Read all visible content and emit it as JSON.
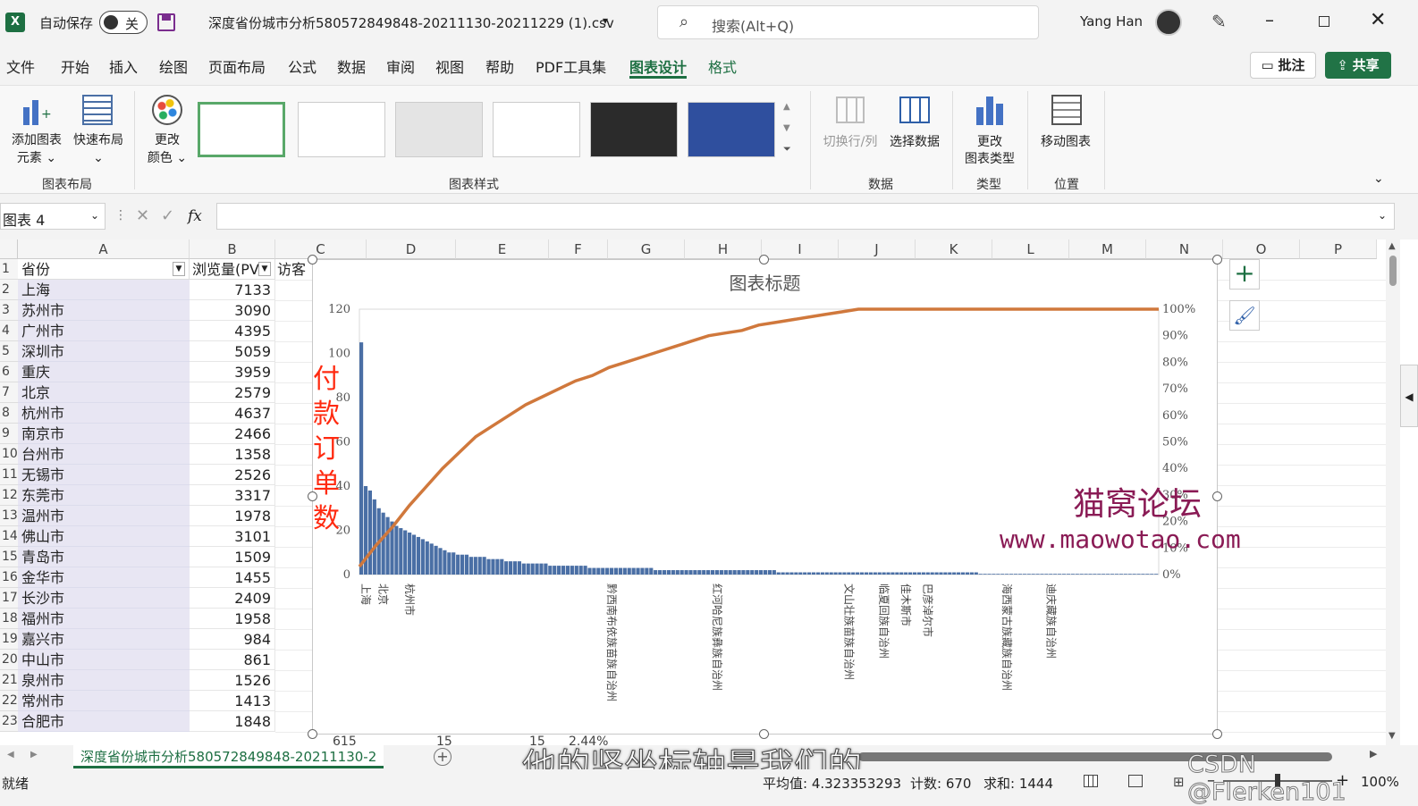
{
  "titlebar": {
    "autosave_label": "自动保存",
    "autosave_state": "关",
    "filename": "深度省份城市分析580572849848-20211130-20211229 (1).csv",
    "search_placeholder": "搜索(Alt+Q)",
    "user": "Yang Han"
  },
  "menu": [
    "文件",
    "开始",
    "插入",
    "绘图",
    "页面布局",
    "公式",
    "数据",
    "审阅",
    "视图",
    "帮助",
    "PDF工具集",
    "图表设计",
    "格式"
  ],
  "menu_active": "图表设计",
  "comments_label": "批注",
  "share_label": "共享",
  "ribbon": {
    "add_element": [
      "添加图表",
      "元素 ⌄"
    ],
    "quick_layout": [
      "快速布局",
      "⌄"
    ],
    "change_color": [
      "更改",
      "颜色 ⌄"
    ],
    "group_layout": "图表布局",
    "group_styles": "图表样式",
    "switch_rowcol": "切换行/列",
    "select_data": "选择数据",
    "group_data": "数据",
    "change_type": [
      "更改",
      "图表类型"
    ],
    "group_type": "类型",
    "move_chart": "移动图表",
    "group_location": "位置"
  },
  "formula": {
    "namebox": "图表 4",
    "fx": "fx"
  },
  "columns": [
    "A",
    "B",
    "C",
    "D",
    "E",
    "F",
    "G",
    "H",
    "I",
    "J",
    "K",
    "L",
    "M",
    "N",
    "O",
    "P"
  ],
  "headers": {
    "a": "省份",
    "b": "浏览量(PV",
    "c": "访客"
  },
  "rows": [
    {
      "n": "2",
      "a": "上海",
      "b": "7133"
    },
    {
      "n": "3",
      "a": "苏州市",
      "b": "3090"
    },
    {
      "n": "4",
      "a": "广州市",
      "b": "4395"
    },
    {
      "n": "5",
      "a": "深圳市",
      "b": "5059"
    },
    {
      "n": "6",
      "a": "重庆",
      "b": "3959"
    },
    {
      "n": "7",
      "a": "北京",
      "b": "2579"
    },
    {
      "n": "8",
      "a": "杭州市",
      "b": "4637"
    },
    {
      "n": "9",
      "a": "南京市",
      "b": "2466"
    },
    {
      "n": "10",
      "a": "台州市",
      "b": "1358"
    },
    {
      "n": "11",
      "a": "无锡市",
      "b": "2526"
    },
    {
      "n": "12",
      "a": "东莞市",
      "b": "3317"
    },
    {
      "n": "13",
      "a": "温州市",
      "b": "1978"
    },
    {
      "n": "14",
      "a": "佛山市",
      "b": "3101"
    },
    {
      "n": "15",
      "a": "青岛市",
      "b": "1509"
    },
    {
      "n": "16",
      "a": "金华市",
      "b": "1455"
    },
    {
      "n": "17",
      "a": "长沙市",
      "b": "2409"
    },
    {
      "n": "18",
      "a": "福州市",
      "b": "1958"
    },
    {
      "n": "19",
      "a": "嘉兴市",
      "b": "984"
    },
    {
      "n": "20",
      "a": "中山市",
      "b": "861"
    },
    {
      "n": "21",
      "a": "泉州市",
      "b": "1526"
    },
    {
      "n": "22",
      "a": "常州市",
      "b": "1413"
    },
    {
      "n": "23",
      "a": "合肥市",
      "b": "1848"
    }
  ],
  "chart_data": {
    "type": "bar",
    "title": "图表标题",
    "annotation": "付款订单数",
    "ylim": [
      0,
      120
    ],
    "y_ticks": [
      "0",
      "20",
      "40",
      "60",
      "80",
      "100",
      "120"
    ],
    "y2_ticks": [
      "0%",
      "10%",
      "20%",
      "30%",
      "40%",
      "50%",
      "60%",
      "70%",
      "80%",
      "90%",
      "100%"
    ],
    "x_labels_visible": [
      "上海",
      "北京",
      "杭州市",
      "黔西南布依族苗族自治州",
      "红河哈尼族彝族自治州",
      "文山壮族苗族自治州",
      "临夏回族自治州",
      "佳木斯市",
      "巴彦淖尔市",
      "海西蒙古族藏族自治州",
      "迪庆藏族自治州"
    ],
    "series": [
      {
        "name": "bar",
        "values": [
          105,
          40,
          38,
          34,
          30,
          28,
          26,
          24,
          22,
          21,
          20,
          19,
          18,
          17,
          16,
          15,
          14,
          13,
          12,
          11,
          10,
          10,
          9,
          9,
          9,
          8,
          8,
          8,
          8,
          7,
          7,
          7,
          7,
          6,
          6,
          6,
          6,
          5,
          5,
          5,
          5,
          5,
          5,
          4,
          4,
          4,
          4,
          4,
          4,
          4,
          4,
          4,
          3,
          3,
          3,
          3,
          3,
          3,
          3,
          3,
          3,
          3,
          3,
          3,
          3,
          3,
          3,
          2,
          2,
          2,
          2,
          2,
          2,
          2,
          2,
          2,
          2,
          2,
          2,
          2,
          2,
          2,
          2,
          2,
          2,
          2,
          2,
          2,
          2,
          2,
          2,
          2,
          2,
          2,
          2,
          1,
          1,
          1,
          1,
          1,
          1,
          1,
          1,
          1,
          1,
          1,
          1,
          1,
          1,
          1,
          1,
          1,
          1,
          1,
          1,
          1,
          1,
          1,
          1,
          1,
          1,
          1,
          1,
          1,
          1,
          1,
          1,
          1,
          1,
          1,
          1,
          1,
          1,
          1,
          1,
          1,
          1,
          1,
          1,
          1,
          1,
          0,
          0,
          0,
          0,
          0,
          0,
          0,
          0,
          0,
          0,
          0,
          0,
          0,
          0,
          0,
          0,
          0,
          0,
          0,
          0,
          0,
          0,
          0,
          0,
          0,
          0,
          0,
          0,
          0,
          0,
          0,
          0,
          0,
          0,
          0,
          0,
          0,
          0,
          0,
          0,
          0
        ]
      },
      {
        "name": "cumulative",
        "values": [
          0.03,
          0.11,
          0.18,
          0.26,
          0.33,
          0.4,
          0.46,
          0.52,
          0.56,
          0.6,
          0.64,
          0.67,
          0.7,
          0.73,
          0.75,
          0.78,
          0.8,
          0.82,
          0.84,
          0.86,
          0.88,
          0.9,
          0.91,
          0.92,
          0.94,
          0.95,
          0.96,
          0.97,
          0.98,
          0.99,
          1.0,
          1.0,
          1.0,
          1.0,
          1.0,
          1.0,
          1.0,
          1.0
        ]
      }
    ],
    "colors": {
      "bar": "#4a6fa5",
      "line": "#d0783c"
    }
  },
  "watermark": {
    "line1": "猫窝论坛",
    "line2": "www.maowotao.com"
  },
  "bottom_row": {
    "c": "615",
    "d": "15",
    "e": "15",
    "f": "2.44%"
  },
  "sheet_tab": "深度省份城市分析580572849848-20211130-2",
  "subtitle_overlay": "他的竖坐标轴是我们的",
  "status": {
    "ready": "就绪",
    "average": "平均值: 4.323353293",
    "count": "计数: 670",
    "sum": "求和: 1444",
    "zoom": "100%"
  },
  "csdn": "CSDN @Flerken101"
}
